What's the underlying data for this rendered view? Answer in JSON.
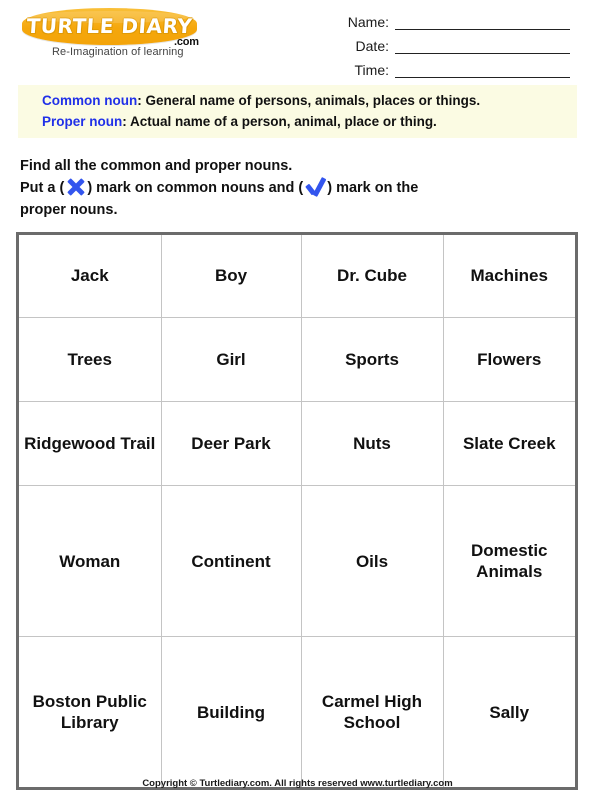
{
  "logo": {
    "word": "TURTLE DIARY",
    "dotcom": ".com",
    "tagline": "Re-Imagination of learning"
  },
  "fields": [
    {
      "label": "Name:",
      "value": ""
    },
    {
      "label": "Date:",
      "value": ""
    },
    {
      "label": "Time:",
      "value": ""
    }
  ],
  "definitions": {
    "common_term": "Common noun",
    "common_text": ": General name of persons, animals, places or things.",
    "proper_term": "Proper noun",
    "proper_text": ": Actual name of a person,  animal,  place or thing."
  },
  "instructions": {
    "line1": "Find all the common and proper nouns.",
    "line2_a": "Put a (",
    "line2_b": ") mark on common nouns and (",
    "line2_c": ") mark on the",
    "line3": "proper nouns.",
    "x_icon_name": "x-mark-icon",
    "check_icon_name": "check-mark-icon"
  },
  "colors": {
    "accent_blue": "#2030e8",
    "mark_blue": "#3355ee",
    "logo_gold": "#f5a70c",
    "definition_bg": "#fbfbe3",
    "table_border": "#6b6b6b",
    "grid_line": "#c4c4c4"
  },
  "table": {
    "rows": [
      [
        "Jack",
        "Boy",
        "Dr. Cube",
        "Machines"
      ],
      [
        "Trees",
        "Girl",
        "Sports",
        "Flowers"
      ],
      [
        "Ridgewood Trail",
        "Deer Park",
        "Nuts",
        "Slate Creek"
      ],
      [
        "Woman",
        "Continent",
        "Oils",
        "Domestic Animals"
      ],
      [
        "Boston Public Library",
        "Building",
        "Carmel High School",
        "Sally"
      ]
    ]
  },
  "footer": {
    "text": "Copyright © Turtlediary.com. All rights reserved  www.turtlediary.com"
  }
}
